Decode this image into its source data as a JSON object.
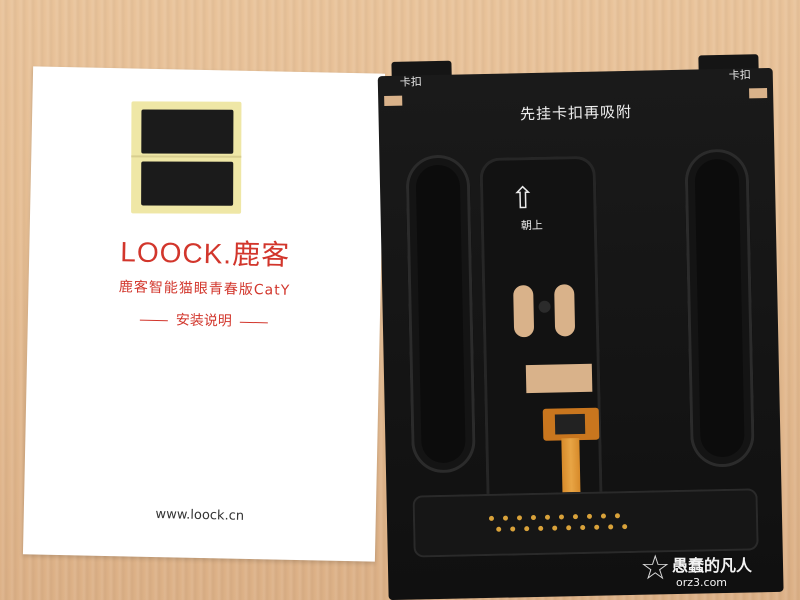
{
  "manual": {
    "brand_en": "LOOCK",
    "brand_sep": ".",
    "brand_cn": "鹿客",
    "product": "鹿客智能猫眼青春版CatY",
    "section_title": "安装说明",
    "website": "www.loock.cn"
  },
  "plate": {
    "tab_left": "卡扣",
    "tab_right": "卡扣",
    "title": "先挂卡扣再吸附",
    "up_arrow": "⇧",
    "up_label": "朝上"
  },
  "watermark": {
    "text": "愚蠢的凡人",
    "sub": "orz3.com"
  },
  "colors": {
    "brand_red": "#d2362c",
    "plate_black": "#111111",
    "table_wood": "#e6bd92",
    "flex_orange": "#c9761e"
  }
}
